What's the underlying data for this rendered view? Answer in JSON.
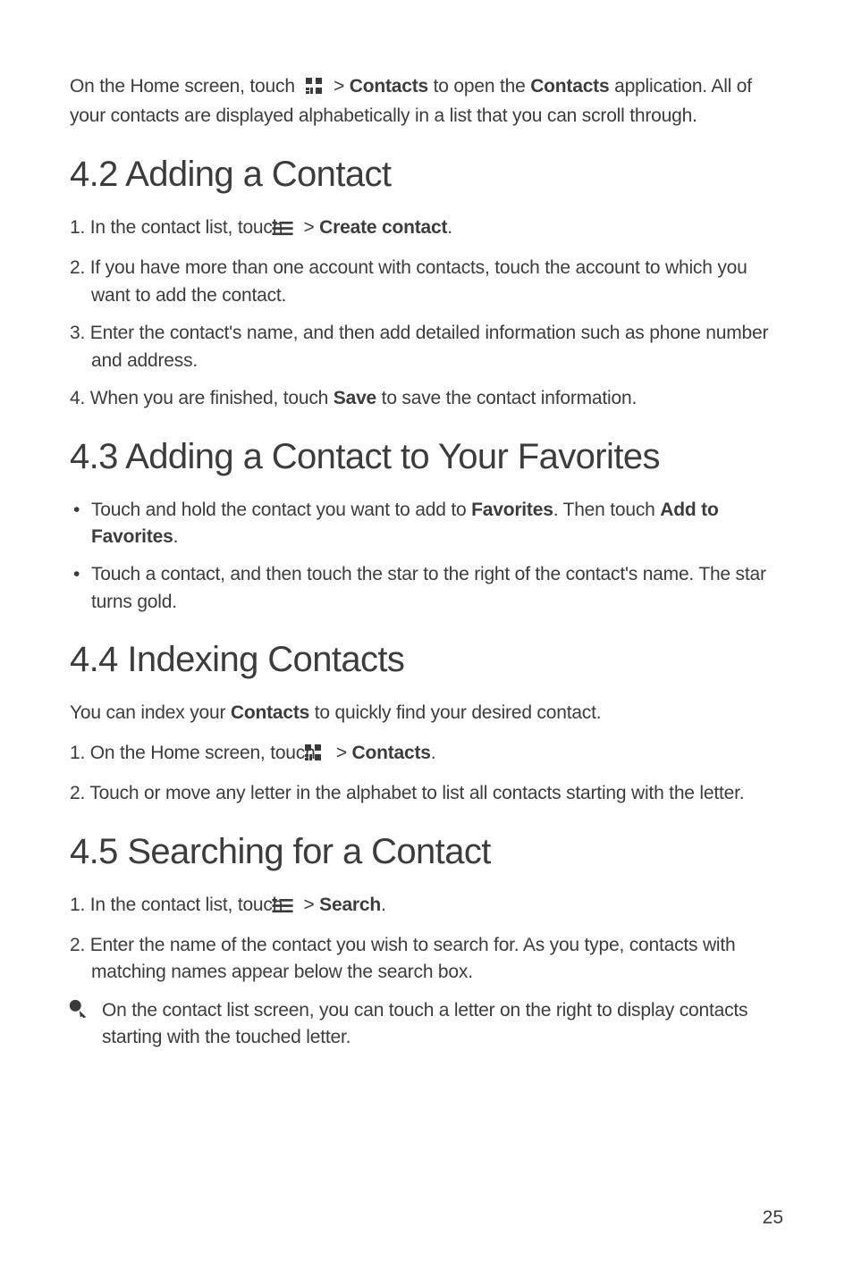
{
  "intro": {
    "p1a": "On the Home screen, touch ",
    "p1b": " > ",
    "p1c": "Contacts",
    "p1d": " to open the ",
    "p1e": "Contacts",
    "p1f": " application. All of your contacts are displayed alphabetically in a list that you can scroll through."
  },
  "s42": {
    "title": "4.2  Adding a Contact",
    "li1a": "In the contact list, touch ",
    "li1b": " > ",
    "li1c": "Create contact",
    "li1d": ".",
    "li2": "If you have more than one account with contacts, touch the account to which you want to add the contact.",
    "li3": "Enter the contact's name, and then add detailed information such as phone number and address.",
    "li4a": "When you are finished, touch ",
    "li4b": "Save",
    "li4c": " to save the contact information."
  },
  "s43": {
    "title": "4.3  Adding a Contact to Your Favorites",
    "li1a": "Touch and hold the contact you want to add to ",
    "li1b": "Favorites",
    "li1c": ". Then touch ",
    "li1d": "Add to Favorites",
    "li1e": ".",
    "li2": "Touch a contact, and then touch the star to the right of the contact's name. The star turns gold."
  },
  "s44": {
    "title": "4.4  Indexing Contacts",
    "p1a": "You can index your ",
    "p1b": "Contacts",
    "p1c": " to quickly find your desired contact.",
    "li1a": "On the Home screen, touch ",
    "li1b": " > ",
    "li1c": "Contacts",
    "li1d": ".",
    "li2": "Touch or move any letter in the alphabet to list all contacts starting with the letter."
  },
  "s45": {
    "title": "4.5  Searching for a Contact",
    "li1a": "In the contact list, touch ",
    "li1b": " > ",
    "li1c": "Search",
    "li1d": ".",
    "li2": "Enter the name of the contact you wish to search for. As you type, contacts with matching names appear below the search box.",
    "note": "On the contact list screen, you can touch a letter on the right to display contacts starting with the touched letter."
  },
  "pageNumber": "25"
}
